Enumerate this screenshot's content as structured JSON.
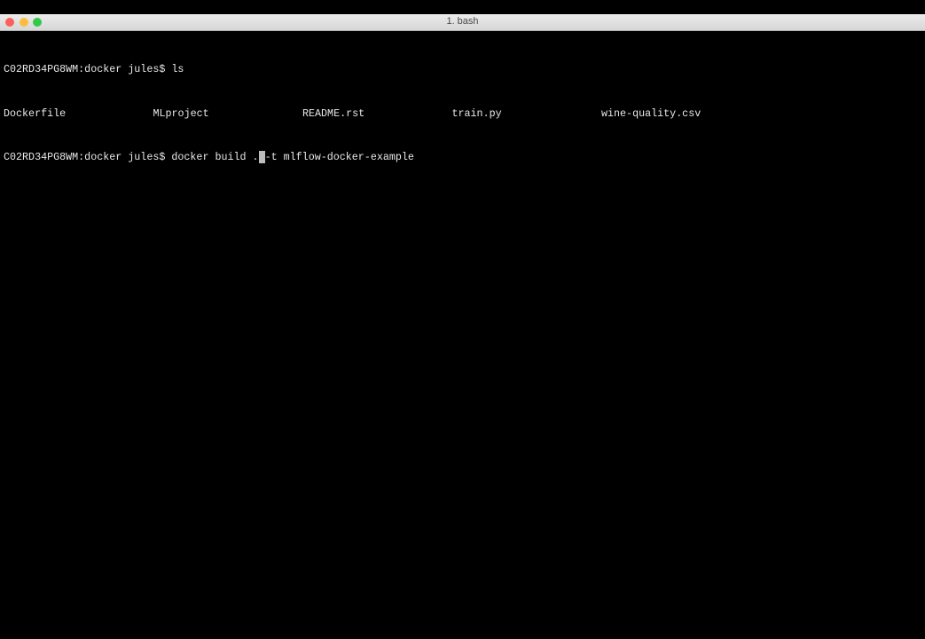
{
  "window": {
    "title": "1. bash",
    "lights": {
      "close": "#fc605c",
      "minimize": "#fdbc40",
      "zoom": "#34c84a"
    }
  },
  "terminal": {
    "prompt": "C02RD34PG8WM:docker jules$ ",
    "line1_command": "ls",
    "files": [
      "Dockerfile",
      "MLproject",
      "README.rst",
      "train.py",
      "wine-quality.csv"
    ],
    "line3_before_cursor": "docker build .",
    "cursor_char": " ",
    "line3_after_cursor": "-t mlflow-docker-example"
  }
}
